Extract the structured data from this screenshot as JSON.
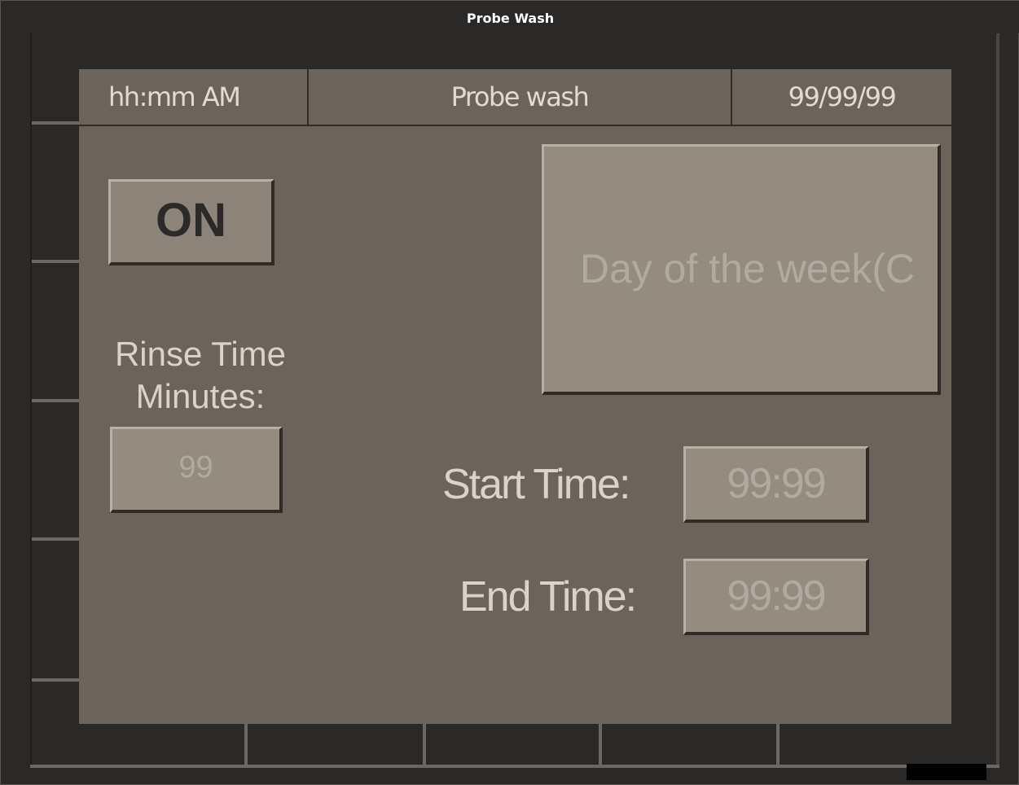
{
  "window": {
    "title": "Probe Wash"
  },
  "header": {
    "time": "hh:mm AM",
    "title": "Probe wash",
    "date": "99/99/99"
  },
  "controls": {
    "on_button_label": "ON",
    "rinse_label_line1": "Rinse Time",
    "rinse_label_line2": "Minutes:",
    "rinse_value": "99",
    "day_of_week_label": "Day of the week(C",
    "start_time_label": "Start Time:",
    "start_time_value": "99:99",
    "end_time_label": "End Time:",
    "end_time_value": "99:99"
  },
  "colors": {
    "panel_background": "#6b645b",
    "window_background": "#2a2927",
    "button_face": "#8c8479",
    "field_face": "#958c80",
    "status_indicator": "#000000"
  }
}
